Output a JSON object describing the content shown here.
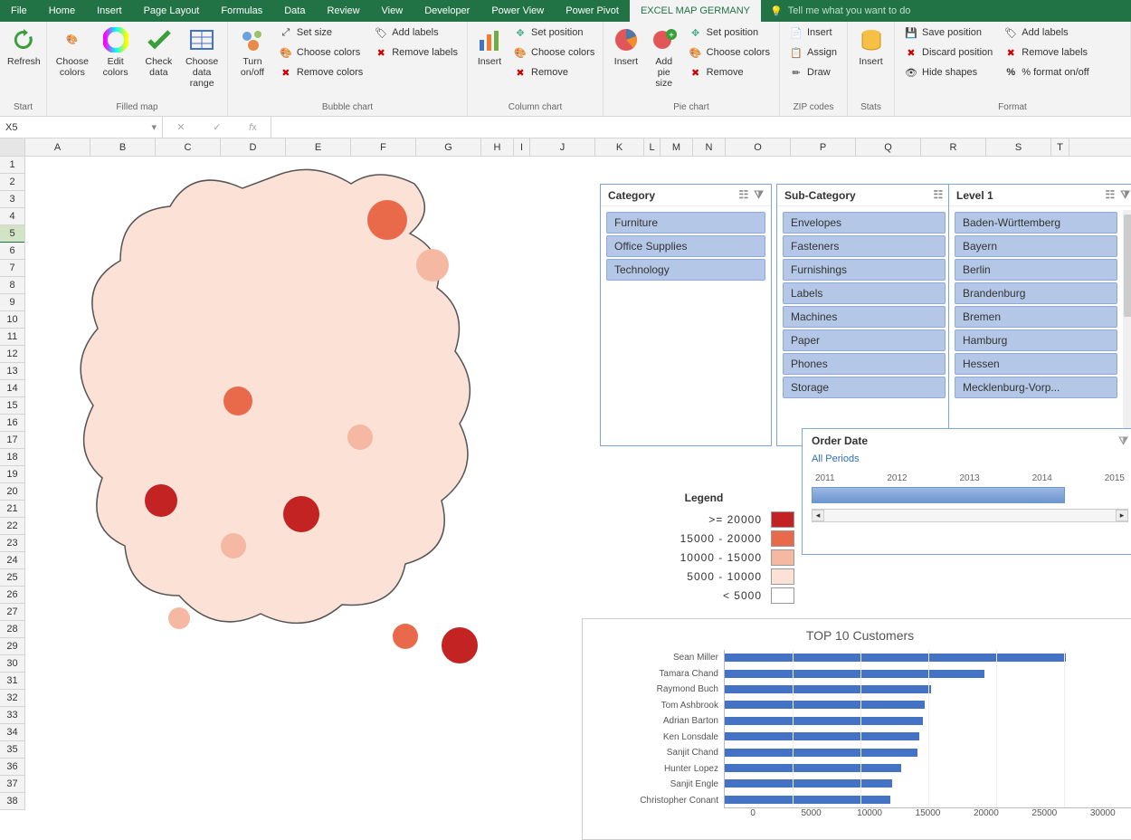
{
  "tabs": [
    "File",
    "Home",
    "Insert",
    "Page Layout",
    "Formulas",
    "Data",
    "Review",
    "View",
    "Developer",
    "Power View",
    "Power Pivot",
    "EXCEL MAP GERMANY"
  ],
  "active_tab": "EXCEL MAP GERMANY",
  "tell_me": "Tell me what you want to do",
  "ribbon": {
    "start": {
      "label": "Start",
      "refresh": "Refresh"
    },
    "filled_map": {
      "label": "Filled map",
      "choose_colors": "Choose colors",
      "edit_colors": "Edit colors",
      "check_data": "Check data",
      "choose_range": "Choose data range"
    },
    "bubble": {
      "label": "Bubble chart",
      "turn": "Turn on/off",
      "set_size": "Set size",
      "choose_colors": "Choose colors",
      "remove_colors": "Remove colors",
      "add_labels": "Add labels",
      "remove_labels": "Remove labels"
    },
    "column": {
      "label": "Column chart",
      "insert": "Insert",
      "set_position": "Set position",
      "choose_colors": "Choose colors",
      "remove": "Remove"
    },
    "pie": {
      "label": "Pie chart",
      "insert": "Insert",
      "add_size": "Add pie size",
      "set_position": "Set position",
      "choose_colors": "Choose colors",
      "remove": "Remove"
    },
    "zip": {
      "label": "ZIP codes",
      "insert": "Insert",
      "assign": "Assign",
      "draw": "Draw"
    },
    "stats": {
      "label": "Stats",
      "insert": "Insert"
    },
    "format": {
      "label": "Format",
      "save_pos": "Save position",
      "discard_pos": "Discard position",
      "hide_shapes": "Hide shapes",
      "add_labels": "Add labels",
      "remove_labels": "Remove labels",
      "pct_format": "% format on/off"
    }
  },
  "name_box": "X5",
  "columns": [
    {
      "n": "A",
      "w": 72
    },
    {
      "n": "B",
      "w": 72
    },
    {
      "n": "C",
      "w": 72
    },
    {
      "n": "D",
      "w": 72
    },
    {
      "n": "E",
      "w": 72
    },
    {
      "n": "F",
      "w": 72
    },
    {
      "n": "G",
      "w": 72
    },
    {
      "n": "H",
      "w": 36
    },
    {
      "n": "I",
      "w": 18
    },
    {
      "n": "J",
      "w": 72
    },
    {
      "n": "K",
      "w": 54
    },
    {
      "n": "L",
      "w": 18
    },
    {
      "n": "M",
      "w": 36
    },
    {
      "n": "N",
      "w": 36
    },
    {
      "n": "O",
      "w": 72
    },
    {
      "n": "P",
      "w": 72
    },
    {
      "n": "Q",
      "w": 72
    },
    {
      "n": "R",
      "w": 72
    },
    {
      "n": "S",
      "w": 72
    },
    {
      "n": "T",
      "w": 20
    }
  ],
  "row_count": 38,
  "selected_row": 5,
  "slicers": {
    "category": {
      "title": "Category",
      "items": [
        "Furniture",
        "Office Supplies",
        "Technology"
      ]
    },
    "sub": {
      "title": "Sub-Category",
      "items": [
        "Envelopes",
        "Fasteners",
        "Furnishings",
        "Labels",
        "Machines",
        "Paper",
        "Phones",
        "Storage"
      ]
    },
    "level1": {
      "title": "Level 1",
      "items": [
        "Baden-Württemberg",
        "Bayern",
        "Berlin",
        "Brandenburg",
        "Bremen",
        "Hamburg",
        "Hessen",
        "Mecklenburg-Vorp..."
      ]
    }
  },
  "timeline": {
    "title": "Order Date",
    "sub": "All Periods",
    "years": [
      "2011",
      "2012",
      "2013",
      "2014",
      "2015"
    ]
  },
  "legend": {
    "title": "Legend",
    "rows": [
      {
        "label": ">=   20000",
        "color": "#c32322"
      },
      {
        "label": "15000  -  20000",
        "color": "#e9694b"
      },
      {
        "label": "10000  -  15000",
        "color": "#f5b8a3"
      },
      {
        "label": "5000  -  10000",
        "color": "#fce1d6"
      },
      {
        "label": "<    5000",
        "color": "#ffffff"
      }
    ]
  },
  "chart_data": {
    "type": "bar",
    "title": "TOP 10 Customers",
    "categories": [
      "Sean Miller",
      "Tamara Chand",
      "Raymond Buch",
      "Tom Ashbrook",
      "Adrian Barton",
      "Ken Lonsdale",
      "Sanjit Chand",
      "Hunter Lopez",
      "Sanjit Engle",
      "Christopher Conant"
    ],
    "values": [
      25100,
      19100,
      15200,
      14700,
      14600,
      14300,
      14200,
      13000,
      12300,
      12200
    ],
    "xlabel": "",
    "ylabel": "",
    "xlim": [
      0,
      30000
    ],
    "xticks": [
      0,
      5000,
      10000,
      15000,
      20000,
      25000,
      30000
    ]
  }
}
